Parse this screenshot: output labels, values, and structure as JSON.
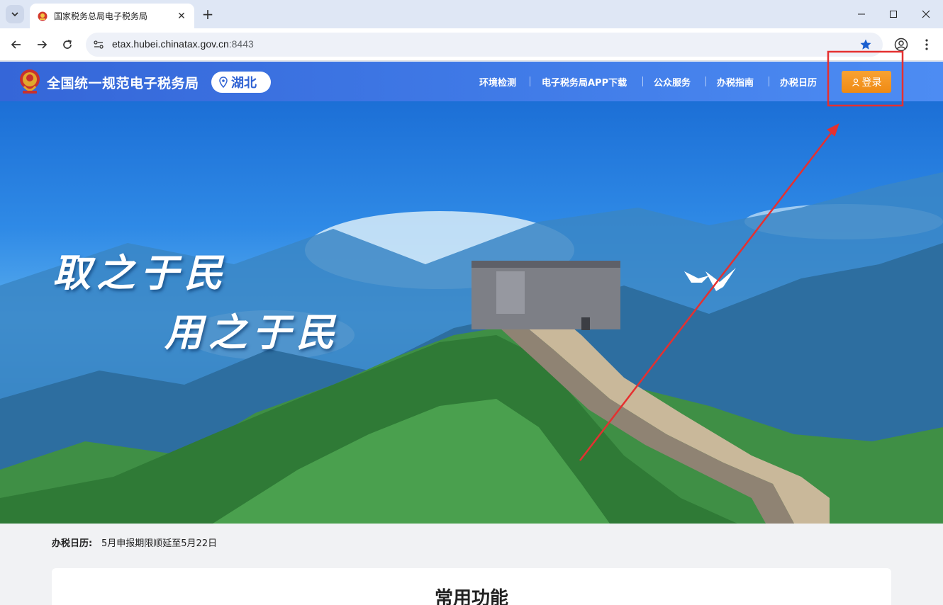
{
  "browser": {
    "tab_title": "国家税务总局电子税务局",
    "url_host": "etax.hubei.chinatax.gov.cn",
    "url_port": ":8443"
  },
  "header": {
    "brand": "全国统一规范电子税务局",
    "region": "湖北",
    "nav": [
      "环境检测",
      "电子税务局APP下载",
      "公众服务",
      "办税指南",
      "办税日历"
    ],
    "login_label": "登录"
  },
  "hero": {
    "slogan_line1": "取之于民",
    "slogan_line2": "用之于民"
  },
  "notice": {
    "label": "办税日历:",
    "text": "5月申报期限顺延至5月22日"
  },
  "section": {
    "title": "常用功能"
  },
  "colors": {
    "header_blue": "#3f79e6",
    "login_orange": "#f39317",
    "annotation_red": "#e53030"
  },
  "icons": [
    "tab-search-icon",
    "favicon-icon",
    "close-icon",
    "plus-icon",
    "minimize-icon",
    "maximize-icon",
    "window-close-icon",
    "back-icon",
    "forward-icon",
    "reload-icon",
    "site-info-icon",
    "bookmark-star-icon",
    "profile-icon",
    "menu-dots-icon",
    "emblem-icon",
    "location-pin-icon",
    "user-icon"
  ]
}
